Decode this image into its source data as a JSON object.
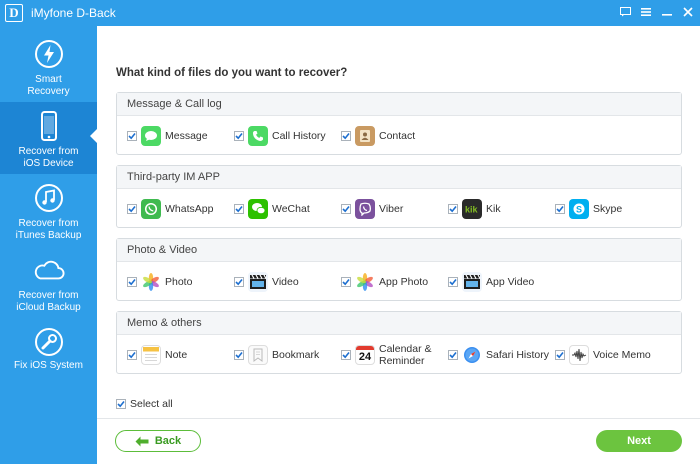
{
  "titlebar": {
    "logo_letter": "D",
    "title": "iMyfone D-Back"
  },
  "sidebar": {
    "items": [
      {
        "label": "Smart\nRecovery",
        "icon": "lightning-icon"
      },
      {
        "label": "Recover from\niOS Device",
        "icon": "iphone-icon",
        "active": true
      },
      {
        "label": "Recover from\niTunes Backup",
        "icon": "music-note-icon"
      },
      {
        "label": "Recover from\niCloud Backup",
        "icon": "cloud-icon"
      },
      {
        "label": "Fix iOS System",
        "icon": "wrench-icon"
      }
    ]
  },
  "main": {
    "question": "What kind of files do you want to recover?",
    "sections": [
      {
        "title": "Message & Call log",
        "items": [
          {
            "label": "Message",
            "icon": "message-icon",
            "checked": true
          },
          {
            "label": "Call History",
            "icon": "phone-icon",
            "checked": true
          },
          {
            "label": "Contact",
            "icon": "contact-icon",
            "checked": true
          }
        ]
      },
      {
        "title": "Third-party IM APP",
        "items": [
          {
            "label": "WhatsApp",
            "icon": "whatsapp-icon",
            "checked": true
          },
          {
            "label": "WeChat",
            "icon": "wechat-icon",
            "checked": true
          },
          {
            "label": "Viber",
            "icon": "viber-icon",
            "checked": true
          },
          {
            "label": "Kik",
            "icon": "kik-icon",
            "checked": true
          },
          {
            "label": "Skype",
            "icon": "skype-icon",
            "checked": true
          }
        ]
      },
      {
        "title": "Photo & Video",
        "items": [
          {
            "label": "Photo",
            "icon": "photos-icon",
            "checked": true
          },
          {
            "label": "Video",
            "icon": "clapper-icon",
            "checked": true
          },
          {
            "label": "App Photo",
            "icon": "photos-icon",
            "checked": true
          },
          {
            "label": "App Video",
            "icon": "clapper-icon",
            "checked": true
          }
        ]
      },
      {
        "title": "Memo & others",
        "items": [
          {
            "label": "Note",
            "icon": "notes-icon",
            "checked": true
          },
          {
            "label": "Bookmark",
            "icon": "bookmark-icon",
            "checked": true
          },
          {
            "label": "Calendar &\nReminder",
            "icon": "calendar-icon",
            "checked": true,
            "calendar_day": "24"
          },
          {
            "label": "Safari History",
            "icon": "safari-icon",
            "checked": true
          },
          {
            "label": "Voice Memo",
            "icon": "voice-memo-icon",
            "checked": true
          }
        ]
      }
    ],
    "select_all_label": "Select all",
    "back_label": "Back",
    "next_label": "Next"
  },
  "colors": {
    "brand_blue": "#2f9ee8",
    "active_blue": "#1d85d4",
    "accent_green": "#6cc43f"
  }
}
